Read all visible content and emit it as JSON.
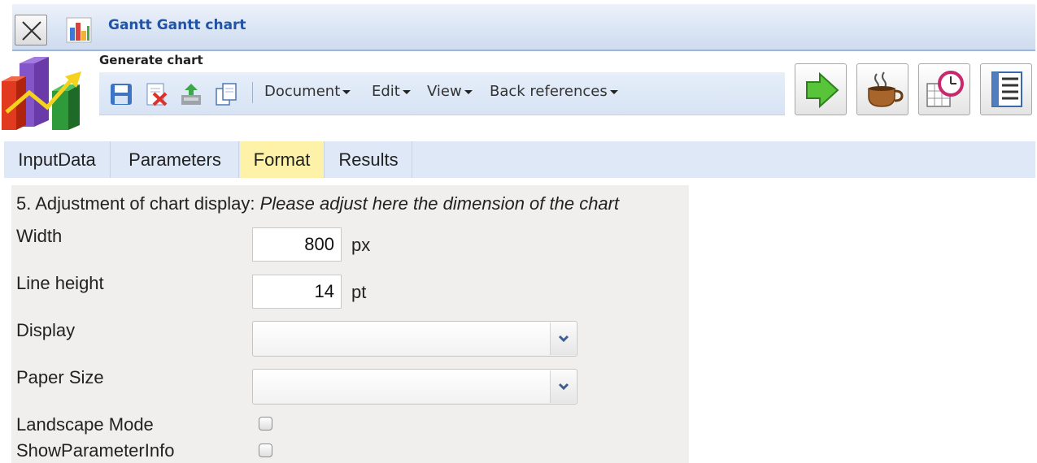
{
  "window": {
    "title": "Gantt Gantt chart"
  },
  "header": {
    "title": "Generate chart"
  },
  "toolbar": {
    "icons": [
      "save-icon",
      "delete-icon",
      "export-icon",
      "copy-icon"
    ],
    "menus": [
      {
        "label": "Document"
      },
      {
        "label": "Edit"
      },
      {
        "label": "View"
      },
      {
        "label": "Back references"
      }
    ]
  },
  "actions": [
    "run-icon",
    "coffee-icon",
    "schedule-icon",
    "report-icon"
  ],
  "tabs": [
    {
      "label": "InputData",
      "active": false
    },
    {
      "label": "Parameters",
      "active": false
    },
    {
      "label": "Format",
      "active": true
    },
    {
      "label": "Results",
      "active": false
    }
  ],
  "form": {
    "heading_prefix": "5. Adjustment of chart display: ",
    "heading_hint": "Please adjust here the dimension of the chart",
    "width": {
      "label": "Width",
      "value": "800",
      "unit": "px"
    },
    "line_height": {
      "label": "Line height",
      "value": "14",
      "unit": "pt"
    },
    "display": {
      "label": "Display",
      "value": ""
    },
    "paper_size": {
      "label": "Paper Size",
      "value": ""
    },
    "landscape_mode": {
      "label": "Landscape Mode",
      "checked": false
    },
    "show_parameter_info": {
      "label": "ShowParameterInfo",
      "checked": false
    }
  },
  "colors": {
    "title_text": "#2353a3",
    "active_tab": "#fdf2a7",
    "tabbar": "#dfe8f6",
    "panel": "#f1efed"
  }
}
